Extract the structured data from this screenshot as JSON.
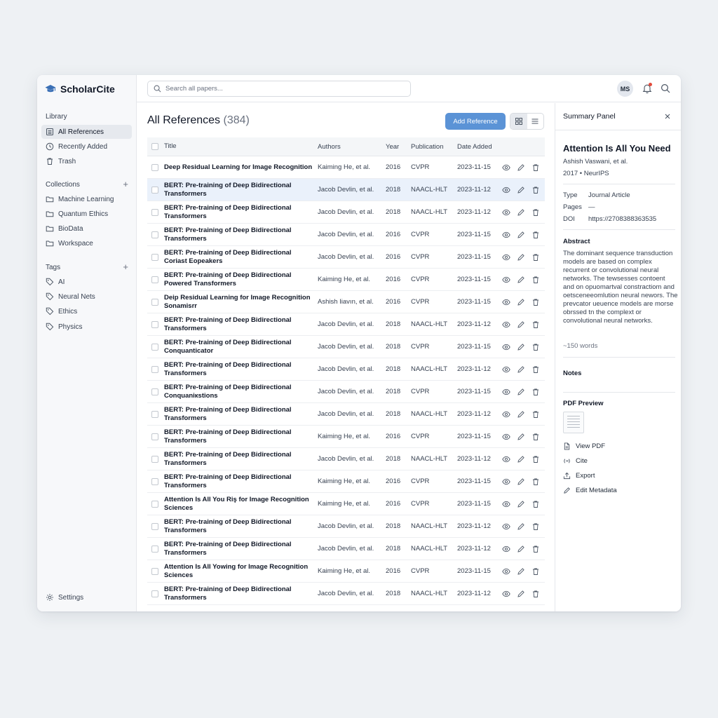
{
  "app": {
    "name": "ScholarCite"
  },
  "sidebar": {
    "library_title": "Library",
    "library_items": [
      {
        "label": "All References",
        "icon": "list-icon",
        "active": true
      },
      {
        "label": "Recently Added",
        "icon": "clock-icon"
      },
      {
        "label": "Trash",
        "icon": "trash-icon"
      }
    ],
    "collections_title": "Collections",
    "collections": [
      {
        "label": "Machine Learning"
      },
      {
        "label": "Quantum Ethics"
      },
      {
        "label": "BioData"
      },
      {
        "label": "Workspace"
      }
    ],
    "tags_title": "Tags",
    "tags": [
      {
        "label": "AI"
      },
      {
        "label": "Neural Nets"
      },
      {
        "label": "Ethics"
      },
      {
        "label": "Physics"
      }
    ],
    "settings_label": "Settings"
  },
  "header": {
    "search_placeholder": "Search all papers...",
    "avatar_initials": "MS"
  },
  "main": {
    "title": "All References",
    "count": "(384)",
    "add_button": "Add Reference",
    "columns": {
      "title": "Title",
      "authors": "Authors",
      "year": "Year",
      "publication": "Publication",
      "date_added": "Date Added"
    },
    "rows": [
      {
        "title": "Deep Residual Learning for Image Recognition",
        "authors": "Kaiming He, et al.",
        "year": "2016",
        "publication": "CVPR",
        "date": "2023-11-15"
      },
      {
        "title": "BERT: Pre-training of Deep Bidirectional Transformers",
        "authors": "Jacob Devlin, et al.",
        "year": "2018",
        "publication": "NAACL-HLT",
        "date": "2023-11-12",
        "selected": true
      },
      {
        "title": "BERT: Pre-training of Deep Bidirectional Transformers",
        "authors": "Jacob Devlin, et al.",
        "year": "2018",
        "publication": "NAACL-HLT",
        "date": "2023-11-12"
      },
      {
        "title": "BERT: Pre-training of Deep Bidirectional Transformers",
        "authors": "Jacob Devlin, et al.",
        "year": "2016",
        "publication": "CVPR",
        "date": "2023-11-15"
      },
      {
        "title": "BERT: Pre-training of Deep Bidirectional Coriast Eopeakers",
        "authors": "Jacob Devlin, et al.",
        "year": "2016",
        "publication": "CVPR",
        "date": "2023-11-15"
      },
      {
        "title": "BERT: Pre-training of Deep Bidirectional Powered Transformers",
        "authors": "Kaiming He, et al.",
        "year": "2016",
        "publication": "CVPR",
        "date": "2023-11-15"
      },
      {
        "title": "Deip Residual Learning for Image Recognition Sonamisrr",
        "authors": "Ashish Iiavın, et al.",
        "year": "2016",
        "publication": "CVPR",
        "date": "2023-11-15"
      },
      {
        "title": "BERT: Pre-training of Deep Bidirectional Transformers",
        "authors": "Jacob Devlin, et al.",
        "year": "2018",
        "publication": "NAACL-HLT",
        "date": "2023-11-12"
      },
      {
        "title": "BERT: Pre-training of Deep Bidirectional Conquanticator",
        "authors": "Jacob Devlin, et al.",
        "year": "2018",
        "publication": "CVPR",
        "date": "2023-11-15"
      },
      {
        "title": "BERT: Pre-training of Deep Bidirectional Transformers",
        "authors": "Jacob Devlin, et al.",
        "year": "2018",
        "publication": "NAACL-HLT",
        "date": "2023-11-12"
      },
      {
        "title": "BERT: Pre-training of Deep Bidirectional Conquaniкstions",
        "authors": "Jacob Devlin, et al.",
        "year": "2018",
        "publication": "CVPR",
        "date": "2023-11-15"
      },
      {
        "title": "BERT: Pre-training of Deep Bidirectional Transformers",
        "authors": "Jacob Devlin, et al.",
        "year": "2018",
        "publication": "NAACL-HLT",
        "date": "2023-11-12"
      },
      {
        "title": "BERT: Pre-training of Deep Bidirectional Transformers",
        "authors": "Kaiming He, et al.",
        "year": "2016",
        "publication": "CVPR",
        "date": "2023-11-15"
      },
      {
        "title": "BERT: Pre-training of Deep Bidirectional Transformers",
        "authors": "Jacob Devlin, et al.",
        "year": "2018",
        "publication": "NAACL-HLT",
        "date": "2023-11-12"
      },
      {
        "title": "BERT: Pre-training of Deep Bidirectional Transformers",
        "authors": "Kaiming He, et al.",
        "year": "2016",
        "publication": "CVPR",
        "date": "2023-11-15"
      },
      {
        "title": "Attention Is All You Riş for Image Recognition Sciences",
        "authors": "Kaiming He, et al.",
        "year": "2016",
        "publication": "CVPR",
        "date": "2023-11-15"
      },
      {
        "title": "BERT: Pre-training of Deep Bidirectional Transformers",
        "authors": "Jacob Devlin, et al.",
        "year": "2018",
        "publication": "NAACL-HLT",
        "date": "2023-11-12"
      },
      {
        "title": "BERT: Pre-training of Deep Bidirectional Transformers",
        "authors": "Jacob Devlin, et al.",
        "year": "2018",
        "publication": "NAACL-HLT",
        "date": "2023-11-12"
      },
      {
        "title": "Attention Is All Yowing for Image Recognition Sciences",
        "authors": "Kaiming He, et al.",
        "year": "2016",
        "publication": "CVPR",
        "date": "2023-11-15"
      },
      {
        "title": "BERT: Pre-training of Deep Bidirectional Transformers",
        "authors": "Jacob Devlin, et al.",
        "year": "2018",
        "publication": "NAACL-HLT",
        "date": "2023-11-12"
      }
    ]
  },
  "panel": {
    "title": "Summary Panel",
    "paper_title": "Attention Is All You Need",
    "authors": "Ashish Vaswani, et al.",
    "venue": "2017 • NeurIPS",
    "type_key": "Type",
    "type_val": "Journal Article",
    "pages_key": "Pages",
    "pages_val": "—",
    "doi_key": "DOI",
    "doi_val": "https://2708388363535",
    "abstract_title": "Abstract",
    "abstract": "The dominant sequence transduction models are based on complex recurrent or convolutional neural networks. The tewsesses contoent and on opuomartval constractiom and oetsceneeomlution neural newors. The prevcator ueuence models are morse obrssed tn the complext or convolutional neural networks.",
    "word_count": "~150 words",
    "notes_title": "Notes",
    "pdf_title": "PDF Preview",
    "actions": [
      {
        "label": "View PDF",
        "icon": "file-icon"
      },
      {
        "label": "Cite",
        "icon": "quote-icon"
      },
      {
        "label": "Export",
        "icon": "export-icon"
      },
      {
        "label": "Edit Metadata",
        "icon": "pencil-icon"
      }
    ]
  },
  "colors": {
    "accent": "#5b93d6",
    "selected_row": "#eaf1fb",
    "sidebar_bg": "#f7f8fa",
    "notification": "#e24a3b"
  }
}
